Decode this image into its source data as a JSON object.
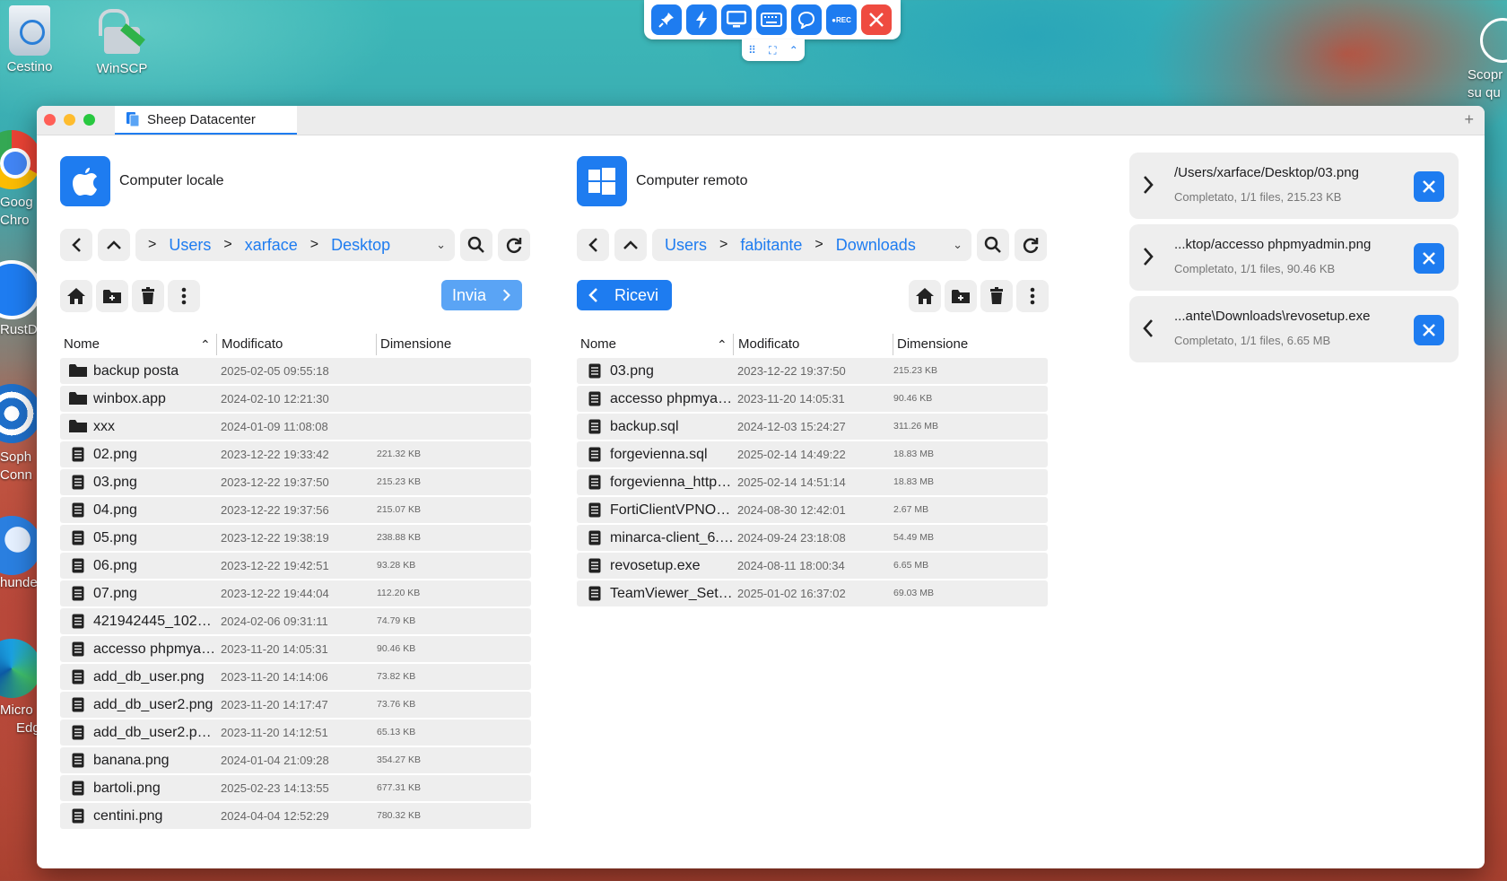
{
  "desktop": {
    "icons": [
      {
        "label": "Cestino"
      },
      {
        "label": "WinSCP"
      }
    ],
    "side_labels": [
      "Goog",
      "Chro",
      "RustD",
      "Soph",
      "Conn",
      "hunde",
      "Micro",
      "Edg"
    ],
    "right_labels": [
      "Scopr",
      "su qu"
    ]
  },
  "remote_toolbar": {
    "rec_label": "●REC"
  },
  "window": {
    "tab_title": "Sheep Datacenter",
    "plus": "+"
  },
  "local": {
    "title": "Computer locale",
    "breadcrumb": [
      "Users",
      "xarface",
      "Desktop"
    ],
    "action_label": "Invia",
    "columns": [
      "Nome",
      "Modificato",
      "Dimensione"
    ],
    "files": [
      {
        "type": "folder",
        "name": "backup posta",
        "modified": "2025-02-05 09:55:18",
        "size": ""
      },
      {
        "type": "folder",
        "name": "winbox.app",
        "modified": "2024-02-10 12:21:30",
        "size": ""
      },
      {
        "type": "folder",
        "name": "xxx",
        "modified": "2024-01-09 11:08:08",
        "size": ""
      },
      {
        "type": "file",
        "name": "02.png",
        "modified": "2023-12-22 19:33:42",
        "size": "221.32 KB"
      },
      {
        "type": "file",
        "name": "03.png",
        "modified": "2023-12-22 19:37:50",
        "size": "215.23 KB"
      },
      {
        "type": "file",
        "name": "04.png",
        "modified": "2023-12-22 19:37:56",
        "size": "215.07 KB"
      },
      {
        "type": "file",
        "name": "05.png",
        "modified": "2023-12-22 19:38:19",
        "size": "238.88 KB"
      },
      {
        "type": "file",
        "name": "06.png",
        "modified": "2023-12-22 19:42:51",
        "size": "93.28 KB"
      },
      {
        "type": "file",
        "name": "07.png",
        "modified": "2023-12-22 19:44:04",
        "size": "112.20 KB"
      },
      {
        "type": "file",
        "name": "421942445_10228...",
        "modified": "2024-02-06 09:31:11",
        "size": "74.79 KB"
      },
      {
        "type": "file",
        "name": "accesso phpmyad...",
        "modified": "2023-11-20 14:05:31",
        "size": "90.46 KB"
      },
      {
        "type": "file",
        "name": "add_db_user.png",
        "modified": "2023-11-20 14:14:06",
        "size": "73.82 KB"
      },
      {
        "type": "file",
        "name": "add_db_user2.png",
        "modified": "2023-11-20 14:17:47",
        "size": "73.76 KB"
      },
      {
        "type": "file",
        "name": "add_db_user2.png~",
        "modified": "2023-11-20 14:12:51",
        "size": "65.13 KB"
      },
      {
        "type": "file",
        "name": "banana.png",
        "modified": "2024-01-04 21:09:28",
        "size": "354.27 KB"
      },
      {
        "type": "file",
        "name": "bartoli.png",
        "modified": "2025-02-23 14:13:55",
        "size": "677.31 KB"
      },
      {
        "type": "file",
        "name": "centini.png",
        "modified": "2024-04-04 12:52:29",
        "size": "780.32 KB"
      }
    ]
  },
  "remote": {
    "title": "Computer remoto",
    "breadcrumb": [
      "Users",
      "fabitante",
      "Downloads"
    ],
    "action_label": "Ricevi",
    "columns": [
      "Nome",
      "Modificato",
      "Dimensione"
    ],
    "files": [
      {
        "type": "file",
        "name": "03.png",
        "modified": "2023-12-22 19:37:50",
        "size": "215.23 KB"
      },
      {
        "type": "file",
        "name": "accesso phpmyad...",
        "modified": "2023-11-20 14:05:31",
        "size": "90.46 KB"
      },
      {
        "type": "file",
        "name": "backup.sql",
        "modified": "2024-12-03 15:24:27",
        "size": "311.26 MB"
      },
      {
        "type": "file",
        "name": "forgevienna.sql",
        "modified": "2025-02-14 14:49:22",
        "size": "18.83 MB"
      },
      {
        "type": "file",
        "name": "forgevienna_https....",
        "modified": "2025-02-14 14:51:14",
        "size": "18.83 MB"
      },
      {
        "type": "file",
        "name": "FortiClientVPNOnli...",
        "modified": "2024-08-30 12:42:01",
        "size": "2.67 MB"
      },
      {
        "type": "file",
        "name": "minarca-client_6.0...",
        "modified": "2024-09-24 23:18:08",
        "size": "54.49 MB"
      },
      {
        "type": "file",
        "name": "revosetup.exe",
        "modified": "2024-08-11 18:00:34",
        "size": "6.65 MB"
      },
      {
        "type": "file",
        "name": "TeamViewer_Setu...",
        "modified": "2025-01-02 16:37:02",
        "size": "69.03 MB"
      }
    ]
  },
  "transfers": [
    {
      "direction": "send",
      "path": "/Users/xarface/Desktop/03.png",
      "status": "Completato, 1/1 files, 215.23 KB"
    },
    {
      "direction": "send",
      "path": "...ktop/accesso phpmyadmin.png",
      "status": "Completato, 1/1 files, 90.46 KB"
    },
    {
      "direction": "receive",
      "path": "...ante\\Downloads\\revosetup.exe",
      "status": "Completato, 1/1 files, 6.65 MB"
    }
  ],
  "colors": {
    "accent": "#1e7cf0",
    "row_bg": "#eeeeee",
    "close_red": "#ef4b40"
  }
}
